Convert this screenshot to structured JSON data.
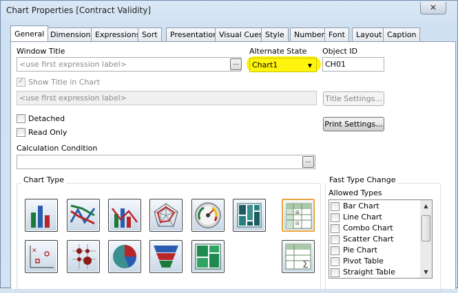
{
  "window": {
    "title": "Chart Properties [Contract Validity]",
    "close_glyph": "✕"
  },
  "tabs": [
    {
      "label": "General"
    },
    {
      "label": "Dimensions"
    },
    {
      "label": "Expressions"
    },
    {
      "label": "Sort"
    },
    {
      "label": "Presentation"
    },
    {
      "label": "Visual Cues"
    },
    {
      "label": "Style"
    },
    {
      "label": "Number"
    },
    {
      "label": "Font"
    },
    {
      "label": "Layout"
    },
    {
      "label": "Caption"
    }
  ],
  "general": {
    "window_title_label": "Window Title",
    "window_title_placeholder": "<use first expression label>",
    "ellipsis": "...",
    "alternate_state_label": "Alternate State",
    "alternate_state_value": "Chart1",
    "object_id_label": "Object ID",
    "object_id_value": "CH01",
    "show_title_label": "Show Title in Chart",
    "show_title_placeholder": "<use first expression label>",
    "title_settings_label": "Title Settings...",
    "detached_label": "Detached",
    "read_only_label": "Read Only",
    "print_settings_label": "Print Settings...",
    "calc_condition_label": "Calculation Condition"
  },
  "chart_type": {
    "group_label": "Chart Type",
    "icons": [
      "bar-chart-icon",
      "line-chart-icon",
      "combo-chart-icon",
      "radar-chart-icon",
      "gauge-chart-icon",
      "mekko-chart-icon",
      "pivot-table-icon",
      "scatter-chart-icon",
      "grid-chart-icon",
      "pie-chart-icon",
      "funnel-chart-icon",
      "block-chart-icon",
      "straight-table-icon"
    ],
    "selected": "pivot-table-icon"
  },
  "fast_type": {
    "group_label": "Fast Type Change",
    "allowed_label": "Allowed Types",
    "items": [
      {
        "label": "Bar Chart"
      },
      {
        "label": "Line Chart"
      },
      {
        "label": "Combo Chart"
      },
      {
        "label": "Scatter Chart"
      },
      {
        "label": "Pie Chart"
      },
      {
        "label": "Pivot Table"
      },
      {
        "label": "Straight Table"
      }
    ]
  }
}
